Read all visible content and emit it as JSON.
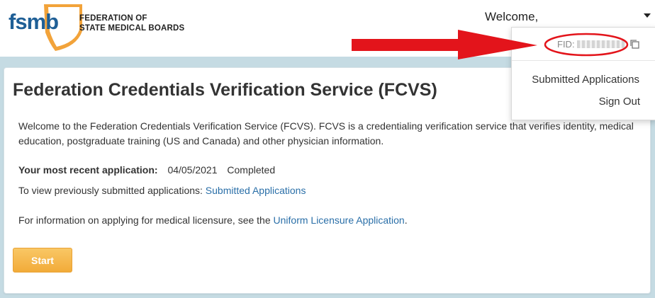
{
  "header": {
    "logo_text": "fsmb",
    "org_name_line1": "FEDERATION OF",
    "org_name_line2": "STATE MEDICAL BOARDS",
    "welcome": "Welcome,"
  },
  "dropdown": {
    "fid_label": "FID:",
    "items": [
      {
        "label": "Submitted Applications"
      },
      {
        "label": "Sign Out"
      }
    ]
  },
  "main": {
    "title": "Federation Credentials Verification Service (FCVS)",
    "intro": "Welcome to the Federation Credentials Verification Service (FCVS). FCVS is a credentialing verification service that verifies identity, medical education, postgraduate training (US and Canada) and other physician information.",
    "recent_label": "Your most recent application:",
    "recent_date": "04/05/2021",
    "recent_status": "Completed",
    "prev_text": "To view previously submitted applications: ",
    "prev_link": "Submitted Applications",
    "licensure_text": "For information on applying for medical licensure, see the ",
    "licensure_link": "Uniform Licensure Application",
    "licensure_end": ".",
    "start_label": "Start"
  },
  "colors": {
    "brand_blue": "#1f5f96",
    "brand_orange": "#f2a33a",
    "band": "#c5dbe3",
    "link": "#2a6fa8",
    "annotation_red": "#e3141b"
  }
}
